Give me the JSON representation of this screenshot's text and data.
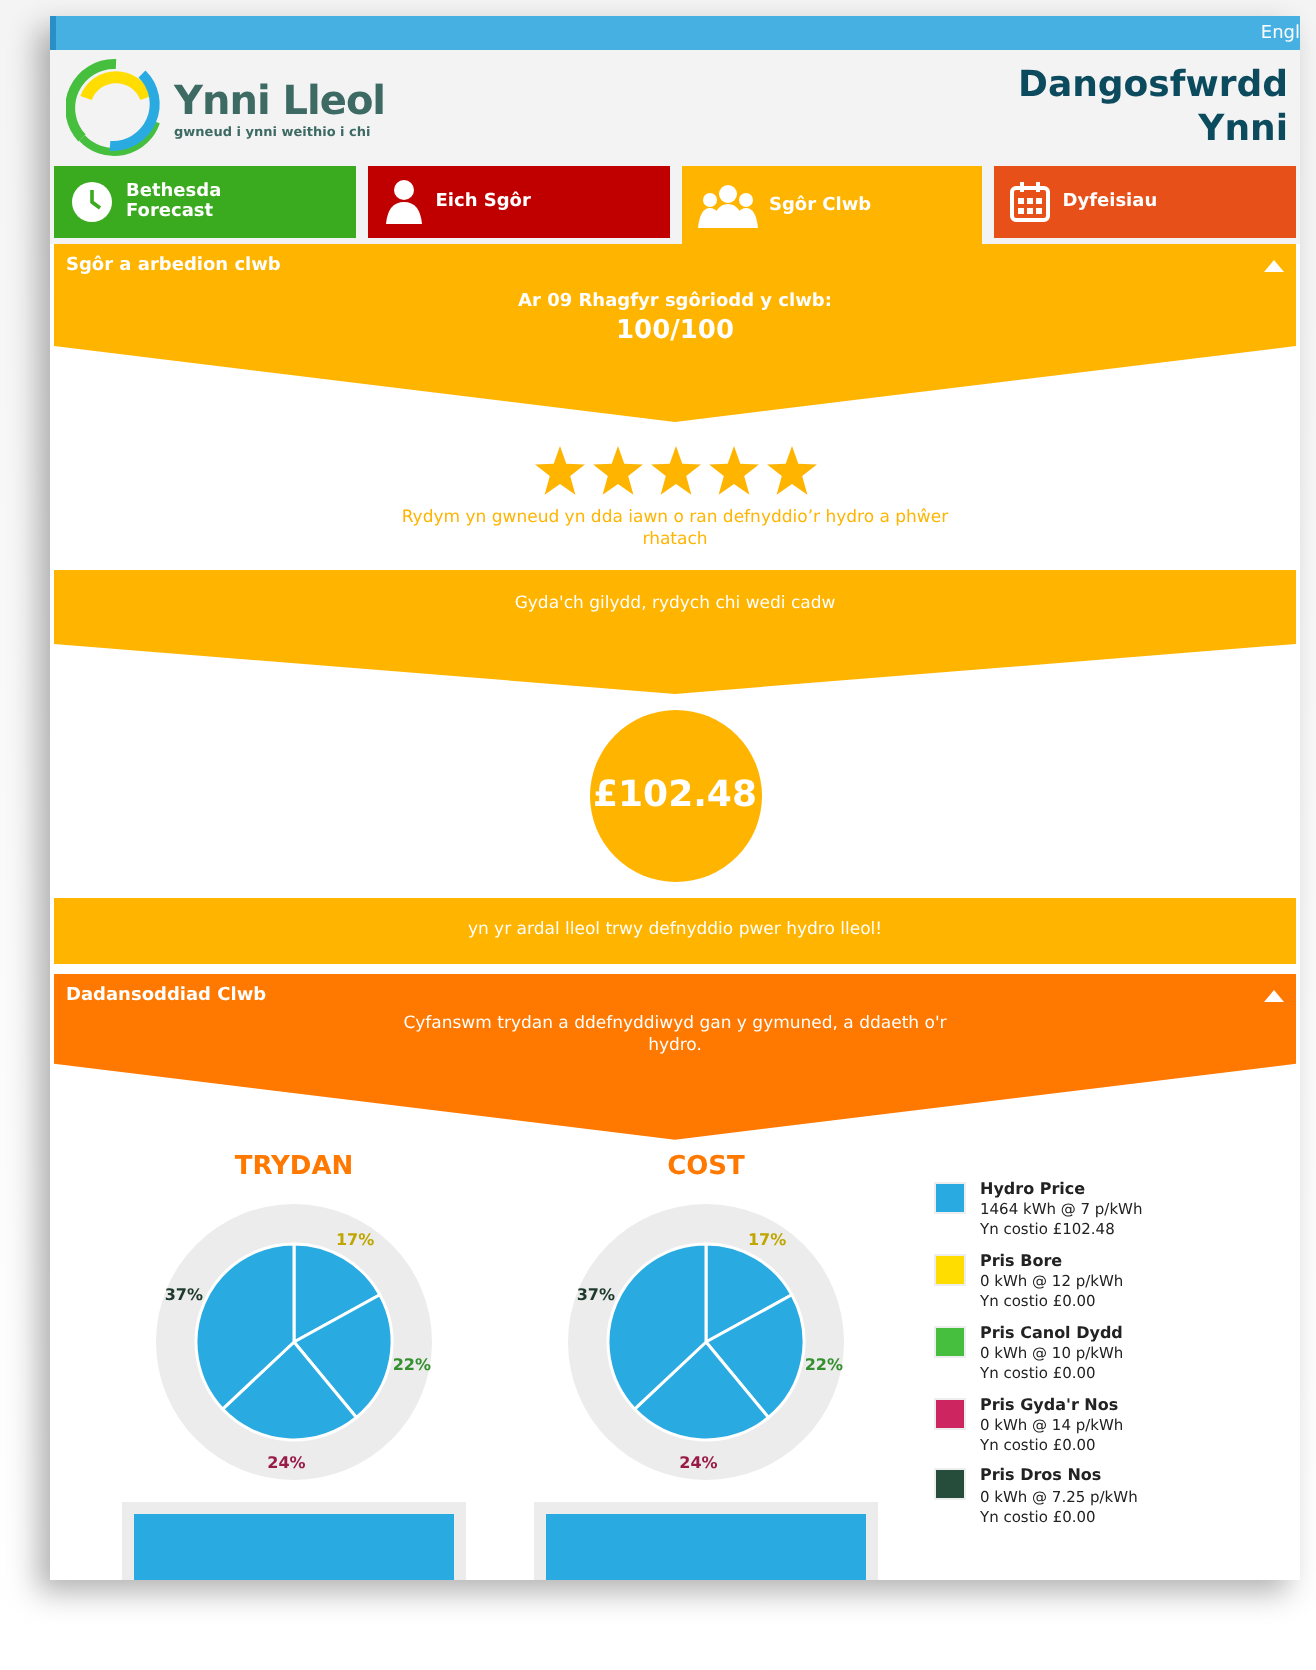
{
  "top_bar": {
    "language_link": "Engl"
  },
  "header": {
    "logo_name": "Ynni Lleol",
    "logo_tagline": "gwneud i ynni weithio i chi",
    "title": "Dangosfwrdd Ynni"
  },
  "tabs": [
    {
      "label": "Bethesda Forecast",
      "kind": "clock",
      "color": "#3aaa1e",
      "selected": false
    },
    {
      "label": "Eich Sgôr",
      "kind": "person",
      "color": "#c00000",
      "selected": false
    },
    {
      "label": "Sgôr Clwb",
      "kind": "group",
      "color": "#ffb400",
      "selected": true
    },
    {
      "label": "Dyfeisiau",
      "kind": "calendar",
      "color": "#e8501a",
      "selected": false
    }
  ],
  "score_section": {
    "title": "Sgôr a arbedion clwb",
    "expanded": true,
    "date_line": "Ar 09 Rhagfyr sgôriodd y clwb:",
    "score": "100/100",
    "stars": 5,
    "message": "Rydym yn gwneud yn dda iawn o ran defnyddio’r hydro a phŵer rhatach",
    "savings_intro": "Gyda'ch gilydd, rydych chi wedi cadw",
    "savings": "£102.48",
    "savings_outro": "yn yr ardal lleol trwy defnyddio pwer hydro lleol!"
  },
  "analysis_section": {
    "title": "Dadansoddiad Clwb",
    "expanded": true,
    "description": "Cyfanswm trydan a ddefnyddiwyd gan y gymuned, a ddaeth o'r hydro.",
    "charts": [
      {
        "chart_data": {
          "type": "pie",
          "title": "TRYDAN",
          "values": [
            17,
            22,
            24,
            37
          ],
          "value_labels": [
            "17%",
            "22%",
            "24%",
            "37%"
          ]
        }
      },
      {
        "chart_data": {
          "type": "pie",
          "title": "COST",
          "values": [
            17,
            22,
            24,
            37
          ],
          "value_labels": [
            "17%",
            "22%",
            "24%",
            "37%"
          ]
        }
      }
    ],
    "legend": [
      {
        "name": "Hydro Price",
        "usage": "1464 kWh @ 7 p/kWh",
        "cost": "Yn costio £102.48",
        "color": "#29abe2"
      },
      {
        "name": "Pris Bore",
        "usage": "0 kWh @ 12 p/kWh",
        "cost": "Yn costio £0.00",
        "color": "#ffdd00"
      },
      {
        "name": "Pris Canol Dydd",
        "usage": "0 kWh @ 10 p/kWh",
        "cost": "Yn costio £0.00",
        "color": "#46bf3f"
      },
      {
        "name": "Pris Gyda'r Nos",
        "usage": "0 kWh @ 14 p/kWh",
        "cost": "Yn costio £0.00",
        "color": "#cc2560"
      },
      {
        "name": "Pris Dros Nos",
        "usage": "0 kWh @ 7.25 p/kWh",
        "cost": "Yn costio £0.00",
        "color": "#264d3c"
      }
    ]
  }
}
